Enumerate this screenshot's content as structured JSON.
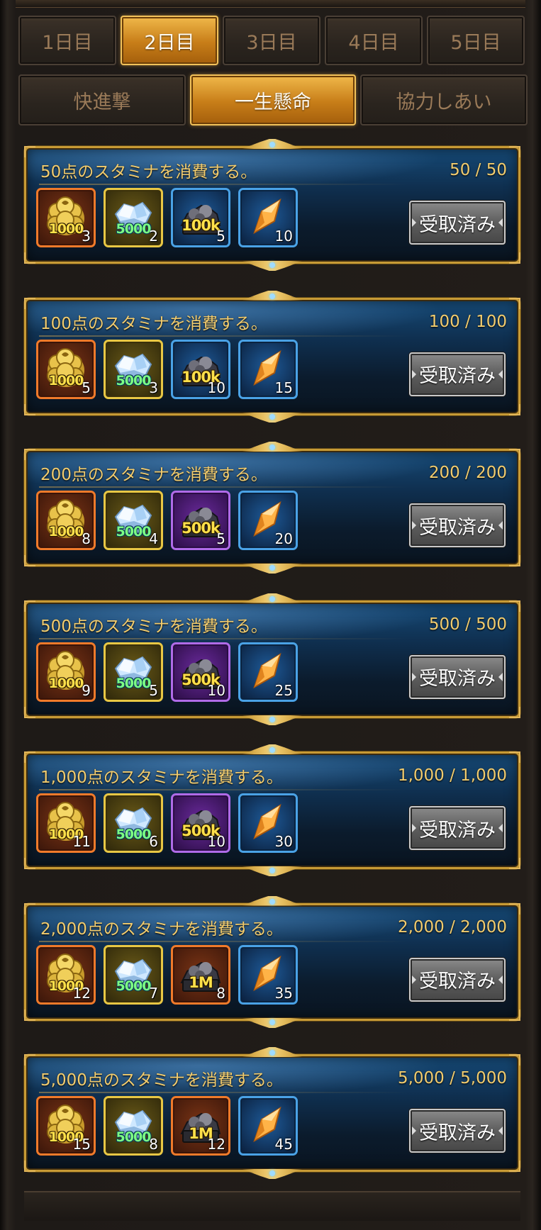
{
  "days": [
    {
      "label": "1日目",
      "active": false
    },
    {
      "label": "2日目",
      "active": true
    },
    {
      "label": "3日目",
      "active": false
    },
    {
      "label": "4日目",
      "active": false
    },
    {
      "label": "5日目",
      "active": false
    }
  ],
  "modes": [
    {
      "label": "快進撃",
      "active": false
    },
    {
      "label": "一生懸命",
      "active": true
    },
    {
      "label": "協力しあい",
      "active": false
    }
  ],
  "quests": [
    {
      "title": "50点のスタミナを消費する。",
      "progress": "50 / 50",
      "button": "受取済み",
      "rewards": [
        {
          "kind": "coin",
          "frame": "orange",
          "label": "1000",
          "count": "3"
        },
        {
          "kind": "diamond",
          "frame": "gold",
          "label": "5000",
          "count": "2"
        },
        {
          "kind": "ore",
          "frame": "blue",
          "label": "100k",
          "count": "5"
        },
        {
          "kind": "crystal",
          "frame": "blue",
          "label": "",
          "count": "10"
        }
      ]
    },
    {
      "title": "100点のスタミナを消費する。",
      "progress": "100 / 100",
      "button": "受取済み",
      "rewards": [
        {
          "kind": "coin",
          "frame": "orange",
          "label": "1000",
          "count": "5"
        },
        {
          "kind": "diamond",
          "frame": "gold",
          "label": "5000",
          "count": "3"
        },
        {
          "kind": "ore",
          "frame": "blue",
          "label": "100k",
          "count": "10"
        },
        {
          "kind": "crystal",
          "frame": "blue",
          "label": "",
          "count": "15"
        }
      ]
    },
    {
      "title": "200点のスタミナを消費する。",
      "progress": "200 / 200",
      "button": "受取済み",
      "rewards": [
        {
          "kind": "coin",
          "frame": "orange",
          "label": "1000",
          "count": "8"
        },
        {
          "kind": "diamond",
          "frame": "gold",
          "label": "5000",
          "count": "4"
        },
        {
          "kind": "ore",
          "frame": "purple",
          "label": "500k",
          "count": "5"
        },
        {
          "kind": "crystal",
          "frame": "blue",
          "label": "",
          "count": "20"
        }
      ]
    },
    {
      "title": "500点のスタミナを消費する。",
      "progress": "500 / 500",
      "button": "受取済み",
      "rewards": [
        {
          "kind": "coin",
          "frame": "orange",
          "label": "1000",
          "count": "9"
        },
        {
          "kind": "diamond",
          "frame": "gold",
          "label": "5000",
          "count": "5"
        },
        {
          "kind": "ore",
          "frame": "purple",
          "label": "500k",
          "count": "10"
        },
        {
          "kind": "crystal",
          "frame": "blue",
          "label": "",
          "count": "25"
        }
      ]
    },
    {
      "title": "1,000点のスタミナを消費する。",
      "progress": "1,000 / 1,000",
      "button": "受取済み",
      "rewards": [
        {
          "kind": "coin",
          "frame": "orange",
          "label": "1000",
          "count": "11"
        },
        {
          "kind": "diamond",
          "frame": "gold",
          "label": "5000",
          "count": "6"
        },
        {
          "kind": "ore",
          "frame": "purple",
          "label": "500k",
          "count": "10"
        },
        {
          "kind": "crystal",
          "frame": "blue",
          "label": "",
          "count": "30"
        }
      ]
    },
    {
      "title": "2,000点のスタミナを消費する。",
      "progress": "2,000 / 2,000",
      "button": "受取済み",
      "rewards": [
        {
          "kind": "coin",
          "frame": "orange",
          "label": "1000",
          "count": "12"
        },
        {
          "kind": "diamond",
          "frame": "gold",
          "label": "5000",
          "count": "7"
        },
        {
          "kind": "ore",
          "frame": "orange",
          "label": "1M",
          "count": "8"
        },
        {
          "kind": "crystal",
          "frame": "blue",
          "label": "",
          "count": "35"
        }
      ]
    },
    {
      "title": "5,000点のスタミナを消費する。",
      "progress": "5,000 / 5,000",
      "button": "受取済み",
      "rewards": [
        {
          "kind": "coin",
          "frame": "orange",
          "label": "1000",
          "count": "15"
        },
        {
          "kind": "diamond",
          "frame": "gold",
          "label": "5000",
          "count": "8"
        },
        {
          "kind": "ore",
          "frame": "orange",
          "label": "1M",
          "count": "12"
        },
        {
          "kind": "crystal",
          "frame": "blue",
          "label": "",
          "count": "45"
        }
      ]
    }
  ]
}
